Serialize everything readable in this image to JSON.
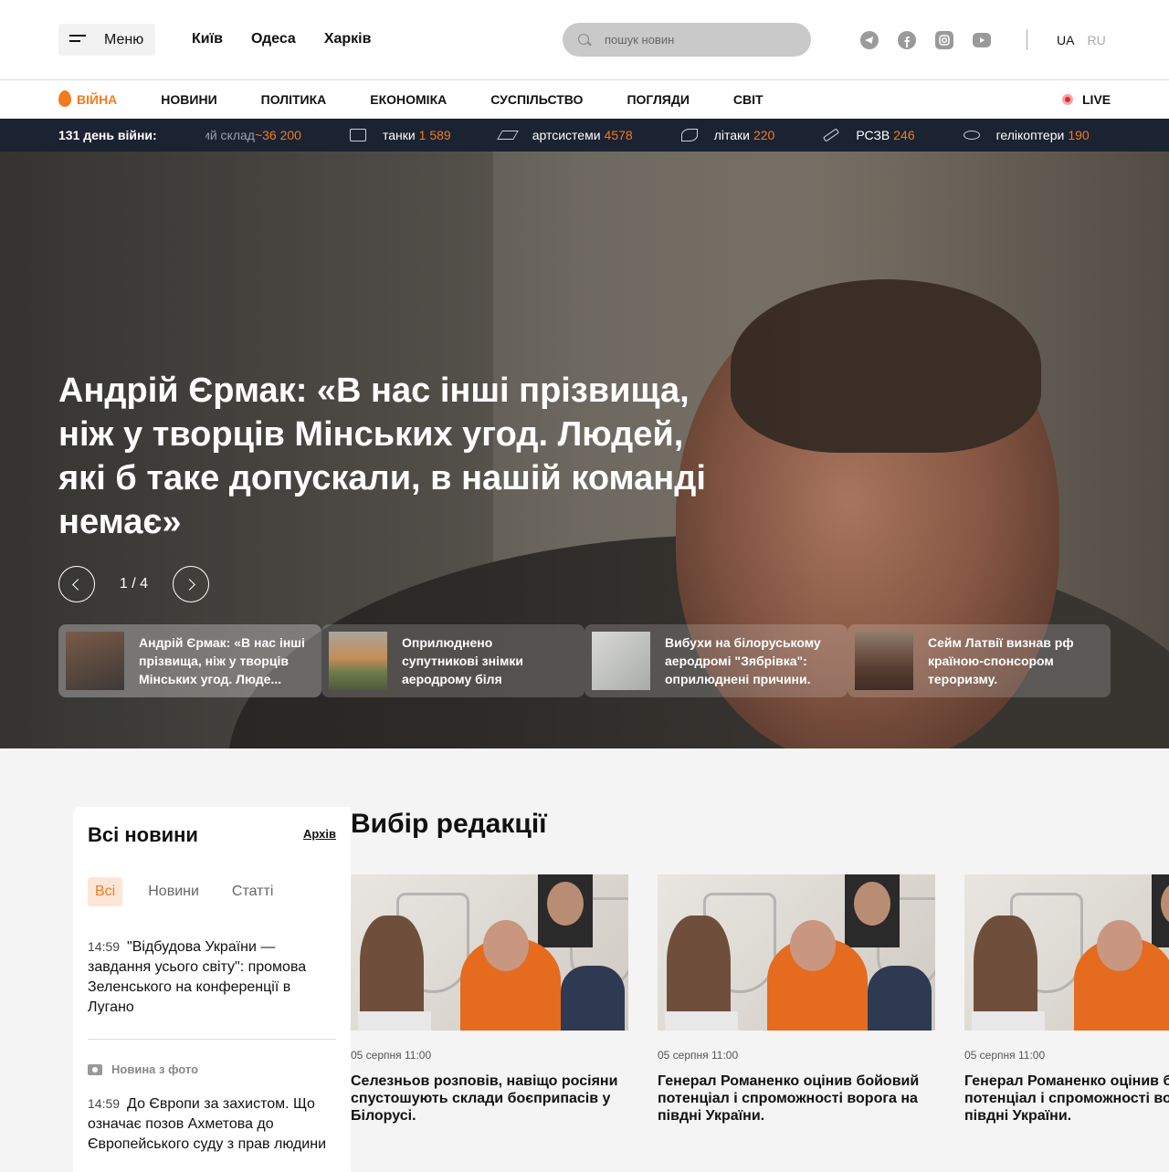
{
  "header": {
    "menu_label": "Меню",
    "cities": [
      "Київ",
      "Одеса",
      "Харків"
    ],
    "search_placeholder": "пошук новин",
    "social_icons": [
      "telegram-icon",
      "facebook-icon",
      "instagram-icon",
      "youtube-icon"
    ],
    "languages": {
      "active": "UA",
      "inactive": "RU"
    }
  },
  "nav": {
    "war_label": "ВІЙНА",
    "items": [
      "НОВИНИ",
      "ПОЛІТИКА",
      "ЕКОНОМІКА",
      "СУСПІЛЬСТВО",
      "ПОГЛЯДИ",
      "СВІТ"
    ],
    "live_label": "LIVE",
    "accent_color": "#f27b1c"
  },
  "ticker": {
    "day_label": "131 день війни:",
    "items": [
      {
        "label": "ий склад",
        "value": "~36 200"
      },
      {
        "label": "танки",
        "value": "1 589"
      },
      {
        "label": "артсистеми",
        "value": "4578"
      },
      {
        "label": "літаки",
        "value": "220"
      },
      {
        "label": "РСЗВ",
        "value": "246"
      },
      {
        "label": "гелікоптери",
        "value": "190"
      }
    ]
  },
  "hero": {
    "headline": "Андрій Єрмак: «В нас інші прізвища, ніж у творців Мінських угод. Людей, які б таке допускали, в нашій команді немає»",
    "pager": "1 / 4",
    "cards": [
      {
        "text": "Андрій Єрмак: «В нас інші прізвища, ніж у творців Мінських угод. Люде..."
      },
      {
        "text": "Оприлюднено супутникові знімки аеродрому біля Новофедорівки: видно мі..."
      },
      {
        "text": "Вибухи на білоруському аеродромі \"Зябрівка\": оприлюднені причини."
      },
      {
        "text": "Сейм Латвії визнав рф країною-спонсором тероризму."
      }
    ]
  },
  "all_news": {
    "title": "Всі новини",
    "archive_label": "Архів",
    "tabs": [
      "Всі",
      "Новини",
      "Статті"
    ],
    "items": [
      {
        "time": "14:59",
        "text": "\"Відбудова України — завдання усього світу\": промова Зеленського на конференції в Лугано"
      },
      {
        "time": "14:59",
        "text": "До Європи за захистом. Що означає позов Ахметова до Європейського суду з прав людини"
      }
    ],
    "photo_tag": "Новина з фото"
  },
  "editors_choice": {
    "title": "Вибір редакції",
    "cards": [
      {
        "meta": "05 серпня 11:00",
        "title": "Селезньов розповів, навіщо росіяни спустошують склади боєприпасів у Білорусі."
      },
      {
        "meta": "05 серпня 11:00",
        "title": "Генерал Романенко оцінив бойовий потенціал і спроможності ворога на півдні України."
      },
      {
        "meta": "05 серпня 11:00",
        "title": "Генерал Романенко оцінив бойовий потенціал і спроможності ворога на півдні України."
      }
    ]
  }
}
